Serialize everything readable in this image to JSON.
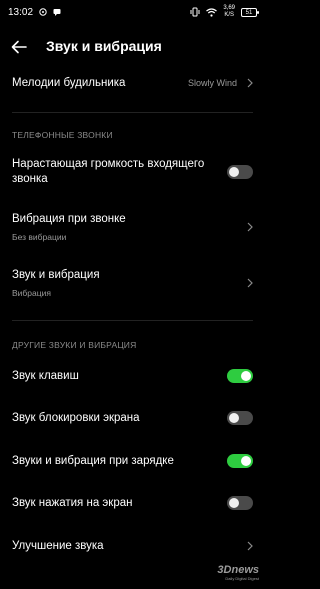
{
  "status_bar": {
    "time": "13:02",
    "speed_value": "3,69",
    "speed_unit": "K/S",
    "battery": "51"
  },
  "header": {
    "title": "Звук и вибрация"
  },
  "alarm": {
    "label": "Мелодии будильника",
    "value": "Slowly Wind"
  },
  "section_calls": {
    "title": "ТЕЛЕФОННЫЕ ЗВОНКИ"
  },
  "rising_volume": {
    "label_line1": "Нарастающая громкость входящего",
    "label_line2": "звонка",
    "enabled": false
  },
  "vibrate_on_ring": {
    "label": "Вибрация при звонке",
    "sub": "Без вибрации"
  },
  "sound_vibration": {
    "label": "Звук и вибрация",
    "sub": "Вибрация"
  },
  "section_other": {
    "title": "ДРУГИЕ ЗВУКИ И ВИБРАЦИЯ"
  },
  "key_sound": {
    "label": "Звук клавиш",
    "enabled": true
  },
  "lock_sound": {
    "label": "Звук блокировки экрана",
    "enabled": false
  },
  "charging_sound": {
    "label": "Звуки и вибрация при зарядке",
    "enabled": true
  },
  "touch_sound": {
    "label": "Звук нажатия на экран",
    "enabled": false
  },
  "sound_enhance": {
    "label": "Улучшение звука"
  },
  "watermark": {
    "main": "3Dnews",
    "sub": "Daily Digital Digest"
  },
  "colors": {
    "toggle_on": "#2ecc40",
    "toggle_off": "#4a4a4a",
    "background": "#000000"
  }
}
